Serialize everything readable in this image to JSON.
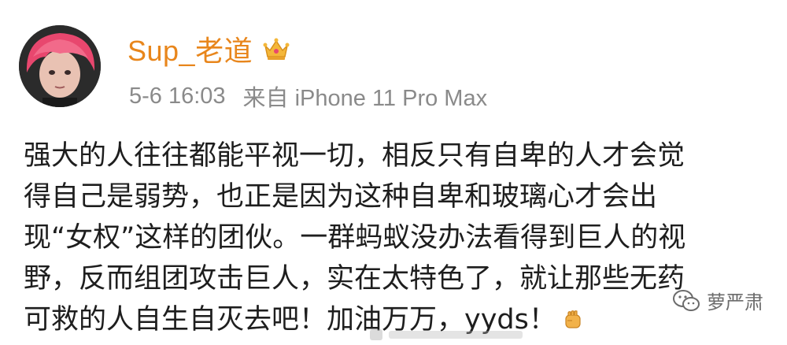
{
  "post": {
    "username": "Sup_老道",
    "timestamp": "5-6 16:03",
    "source": "来自 iPhone 11 Pro Max",
    "body_lines": [
      "强大的人往往都能平视一切，相反只有自卑的人才会觉",
      "得自己是弱势，也正是因为这种自卑和玻璃心才会出",
      "现“女权”这样的团伙。一群蚂蚁没办法看得到巨人的视",
      "野，反而组团攻击巨人，实在太特色了，就让那些无药",
      "可救的人自生自灭去吧！加油万万，yyds！"
    ],
    "icons": {
      "avatar": "avatar-pink-hair",
      "badge": "crown-vip-icon",
      "emoji": "fist-emoji-icon"
    }
  },
  "watermark": {
    "label": "萝严肃",
    "icon": "wechat-icon"
  },
  "colors": {
    "username": "#e8861c",
    "meta": "#8a8a8a",
    "text": "#1e1e1e"
  }
}
